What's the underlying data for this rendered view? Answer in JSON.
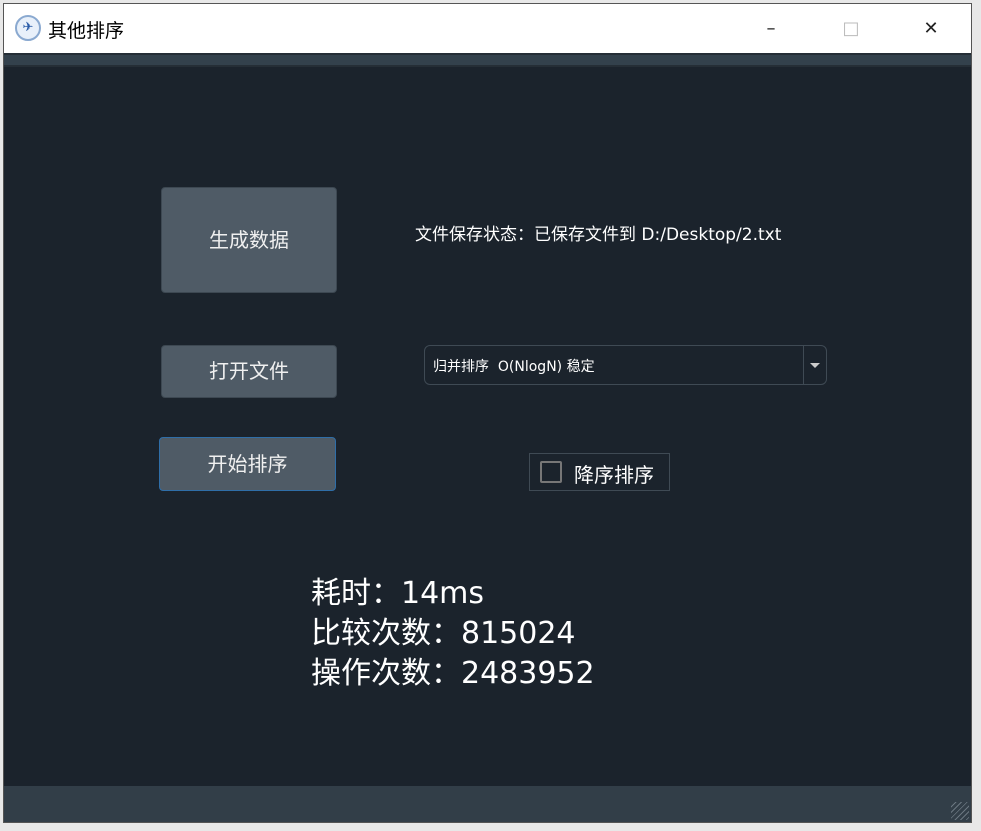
{
  "window": {
    "title": "其他排序",
    "minimize": "–",
    "maximize": "□",
    "close": "✕"
  },
  "buttons": {
    "generate": "生成数据",
    "open_file": "打开文件",
    "start_sort": "开始排序"
  },
  "file_status": "文件保存状态：已保存文件到 D:/Desktop/2.txt",
  "algorithm_select": {
    "selected": "归并排序  O(NlogN) 稳定"
  },
  "descending": {
    "label": "降序排序",
    "checked": false
  },
  "stats": {
    "time": "耗时：14ms",
    "comparisons": "比较次数：815024",
    "operations": "操作次数：2483952"
  }
}
